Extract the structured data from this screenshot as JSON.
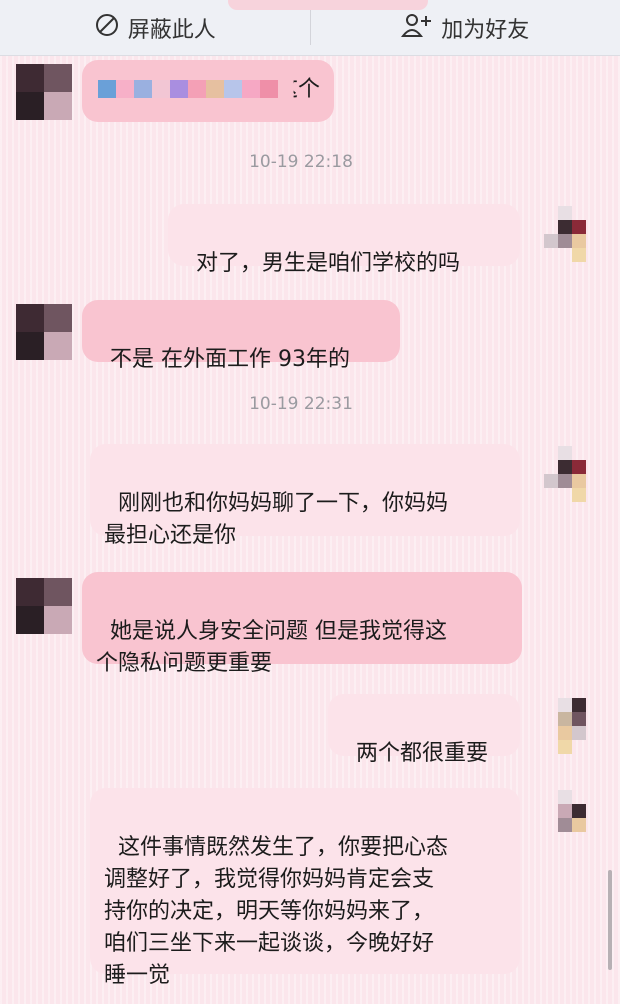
{
  "topbar": {
    "block_label": "屏蔽此人",
    "add_friend_label": "加为好友"
  },
  "timestamps": [
    "10-19 22:18",
    "10-19 22:31"
  ],
  "messages": [
    {
      "from": "other",
      "text": "这个"
    },
    {
      "from": "self",
      "text": "对了，男生是咱们学校的吗"
    },
    {
      "from": "other",
      "text": "不是 在外面工作 93年的"
    },
    {
      "from": "self",
      "text": "刚刚也和你妈妈聊了一下，你妈妈\n最担心还是你"
    },
    {
      "from": "other",
      "text": "她是说人身安全问题 但是我觉得这\n个隐私问题更重要"
    },
    {
      "from": "self",
      "text": "两个都很重要"
    },
    {
      "from": "self",
      "text": "这件事情既然发生了，你要把心态\n调整好了，我觉得你妈妈肯定会支\n持你的决定，明天等你妈妈来了，\n咱们三坐下来一起谈谈，今晚好好\n睡一觉"
    }
  ],
  "colors": {
    "background": "#fbe6ec",
    "other_bubble": "#f9c4d0",
    "self_bubble": "#fce3ea",
    "topbar": "#eef0f5"
  }
}
